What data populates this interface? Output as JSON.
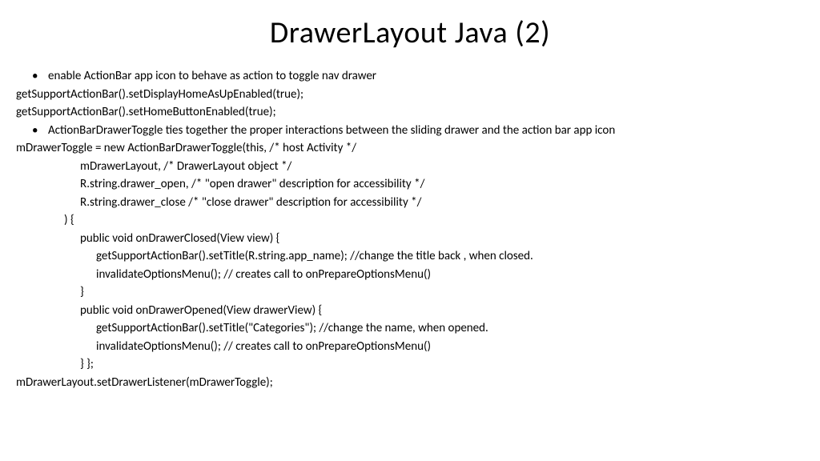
{
  "title": "DrawerLayout Java (2)",
  "lines": {
    "b1": "enable ActionBar app icon to behave as action to toggle nav drawer",
    "l1": "getSupportActionBar().setDisplayHomeAsUpEnabled(true);",
    "l2": "getSupportActionBar().setHomeButtonEnabled(true);",
    "b2": "ActionBarDrawerToggle ties together the proper interactions between the sliding drawer and the action bar app icon",
    "l3": "mDrawerToggle = new ActionBarDrawerToggle(this, /* host Activity */",
    "l4": "mDrawerLayout, /* DrawerLayout object */",
    "l5": "R.string.drawer_open, /* \"open drawer\" description for accessibility */",
    "l6": "R.string.drawer_close /* \"close drawer\" description for accessibility */",
    "l7": ") {",
    "l8": "public void onDrawerClosed(View view) {",
    "l9": "getSupportActionBar().setTitle(R.string.app_name);  //change the title back , when closed.",
    "l10": "invalidateOptionsMenu(); // creates call to onPrepareOptionsMenu()",
    "l11": "}",
    "l12": "public void onDrawerOpened(View drawerView) {",
    "l13": "getSupportActionBar().setTitle(\"Categories\"); //change the name, when opened.",
    "l14": "invalidateOptionsMenu(); // creates call to onPrepareOptionsMenu()",
    "l15": "}        };",
    "l16": "mDrawerLayout.setDrawerListener(mDrawerToggle);"
  }
}
